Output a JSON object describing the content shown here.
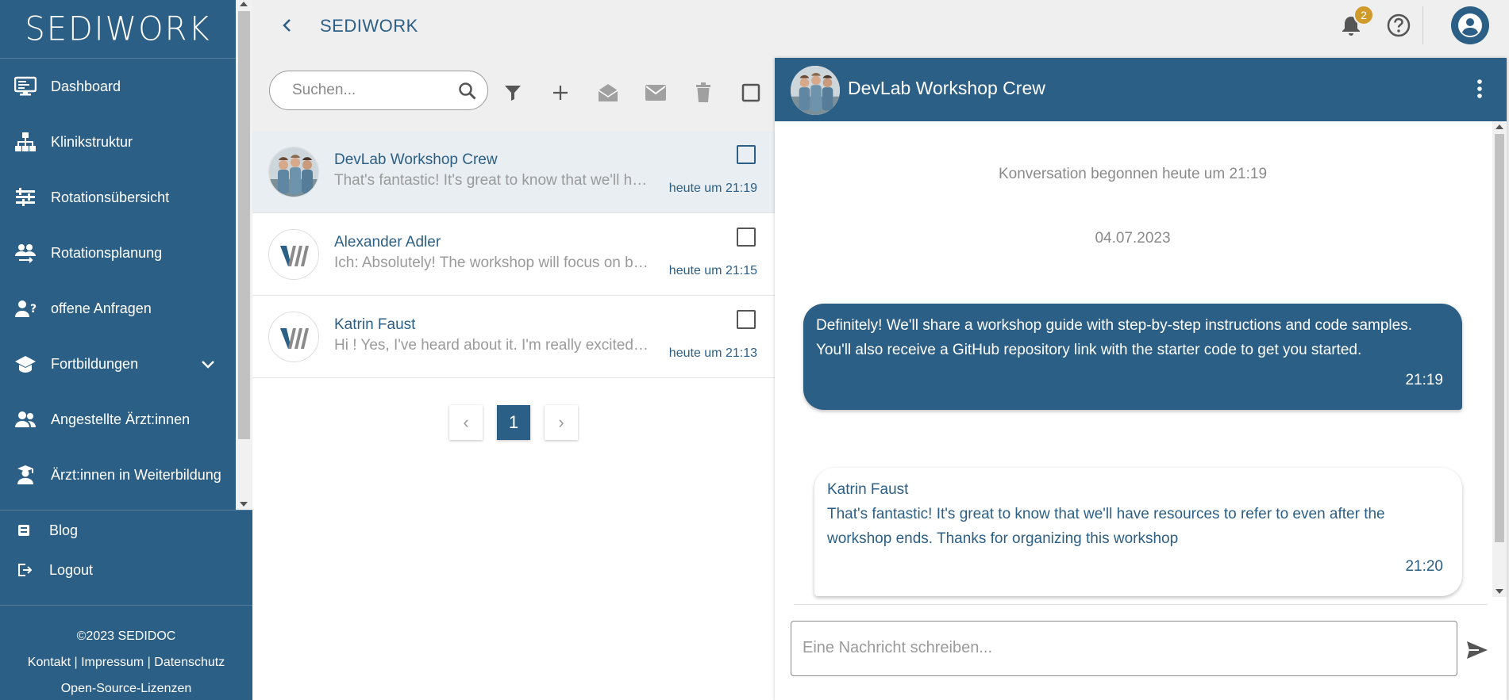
{
  "app": {
    "logo": "SEDIWORK",
    "title": "SEDIWORK",
    "notification_count": "2"
  },
  "sidebar": {
    "items": [
      {
        "label": "Dashboard",
        "icon": "monitor-icon"
      },
      {
        "label": "Klinikstruktur",
        "icon": "hierarchy-icon"
      },
      {
        "label": "Rotationsübersicht",
        "icon": "sliders-icon"
      },
      {
        "label": "Rotationsplanung",
        "icon": "people-swap-icon"
      },
      {
        "label": "offene Anfragen",
        "icon": "person-question-icon"
      },
      {
        "label": "Fortbildungen",
        "icon": "graduation-cap-icon"
      },
      {
        "label": "Angestellte Ärzt:innen",
        "icon": "people-icon"
      },
      {
        "label": "Ärzt:innen in Weiterbildung",
        "icon": "student-icon"
      }
    ],
    "bottom_items": [
      {
        "label": "Blog",
        "icon": "blog-icon"
      },
      {
        "label": "Logout",
        "icon": "logout-icon"
      }
    ],
    "footer": {
      "copyright": "©2023 SEDIDOC",
      "kontakt": "Kontakt",
      "impressum": "Impressum",
      "datenschutz": "Datenschutz",
      "separator": "|",
      "licenses": "Open-Source-Lizenzen"
    }
  },
  "search": {
    "placeholder": "Suchen...",
    "value": ""
  },
  "conversations": [
    {
      "name": "DevLab Workshop Crew",
      "preview": "That's fantastic! It's great to know that we'll have resources to refer to",
      "time": "heute um 21:19",
      "active": true
    },
    {
      "name": "Alexander Adler",
      "preview": "Ich: Absolutely! The workshop will focus on building apps",
      "time": "heute um 21:15",
      "active": false
    },
    {
      "name": "Katrin Faust",
      "preview": "Hi ! Yes, I've heard about it. I'm really excited about it",
      "time": "heute um 21:13",
      "active": false
    }
  ],
  "pagination": {
    "current": "1",
    "prev": "‹",
    "next": "›"
  },
  "chat": {
    "title": "DevLab Workshop Crew",
    "started": "Konversation begonnen heute um 21:19",
    "date": "04.07.2023",
    "messages": [
      {
        "sender": "",
        "text": "Definitely! We'll share a workshop guide with step-by-step instructions and code samples. You'll also receive a GitHub repository link with the starter code to get you started.",
        "time": "21:19",
        "outgoing": true
      },
      {
        "sender": "Katrin Faust",
        "text": "That's fantastic! It's great to know that we'll have resources to refer to even after the workshop ends. Thanks for organizing this workshop",
        "time": "21:20",
        "outgoing": false
      }
    ],
    "input_placeholder": "Eine Nachricht schreiben..."
  },
  "colors": {
    "primary": "#2c5f85",
    "badge": "#d19b2c",
    "background": "#efefef"
  }
}
